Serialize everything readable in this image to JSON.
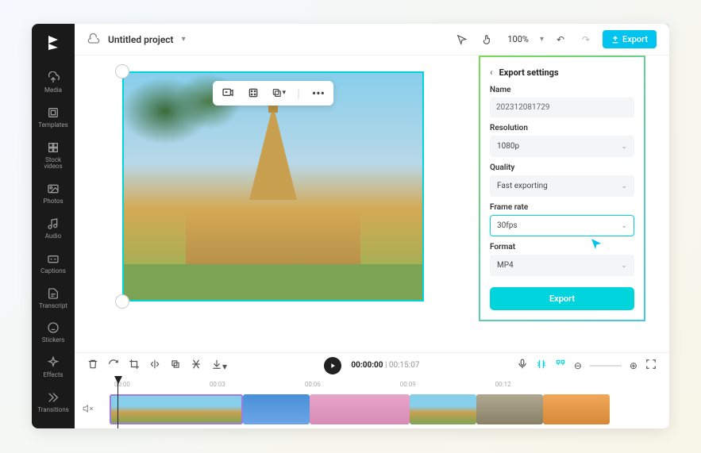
{
  "sidebar": {
    "items": [
      {
        "label": "Media"
      },
      {
        "label": "Templates"
      },
      {
        "label": "Stock\nvideos"
      },
      {
        "label": "Photos"
      },
      {
        "label": "Audio"
      },
      {
        "label": "Captions"
      },
      {
        "label": "Transcript"
      },
      {
        "label": "Stickers"
      },
      {
        "label": "Effects"
      },
      {
        "label": "Transitions"
      }
    ]
  },
  "topbar": {
    "project_name": "Untitled project",
    "zoom": "100%",
    "export_label": "Export"
  },
  "export_panel": {
    "title": "Export settings",
    "name_label": "Name",
    "name_value": "202312081729",
    "resolution_label": "Resolution",
    "resolution_value": "1080p",
    "quality_label": "Quality",
    "quality_value": "Fast exporting",
    "framerate_label": "Frame rate",
    "framerate_value": "30fps",
    "format_label": "Format",
    "format_value": "MP4",
    "action_label": "Export"
  },
  "timeline": {
    "current_time": "00:00:00",
    "duration": "00:15:07",
    "ruler": [
      "00:00",
      "00:03",
      "00:06",
      "00:09",
      "00:12"
    ]
  }
}
